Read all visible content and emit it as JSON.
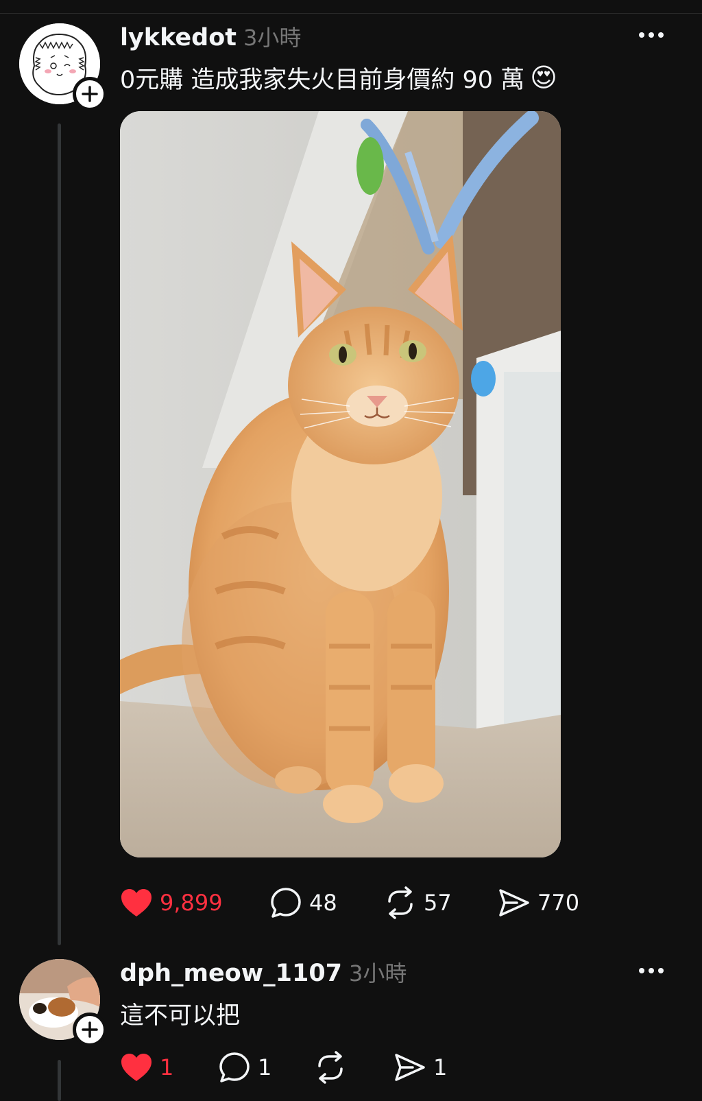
{
  "post": {
    "username": "lykkedot",
    "time": "3小時",
    "text": "0元購 造成我家失火目前身價約 90 萬",
    "emoji": "😍",
    "photo_alt": "orange tabby cat sitting",
    "actions": {
      "likes": "9,899",
      "comments": "48",
      "reposts": "57",
      "shares": "770",
      "liked": true,
      "like_color": "#ff3040"
    }
  },
  "reply": {
    "username": "dph_meow_1107",
    "time": "3小時",
    "text": "這不可以把",
    "actions": {
      "likes": "1",
      "comments": "1",
      "reposts": "",
      "shares": "1",
      "liked": true
    }
  },
  "icons": {
    "more": "more-dots-icon",
    "heart": "heart-icon",
    "comment": "comment-icon",
    "repost": "repost-icon",
    "share": "share-icon",
    "follow": "plus-icon"
  },
  "colors": {
    "background": "#101010",
    "text": "#f3f5f7",
    "secondary": "#777777",
    "accent_like": "#ff3040"
  }
}
